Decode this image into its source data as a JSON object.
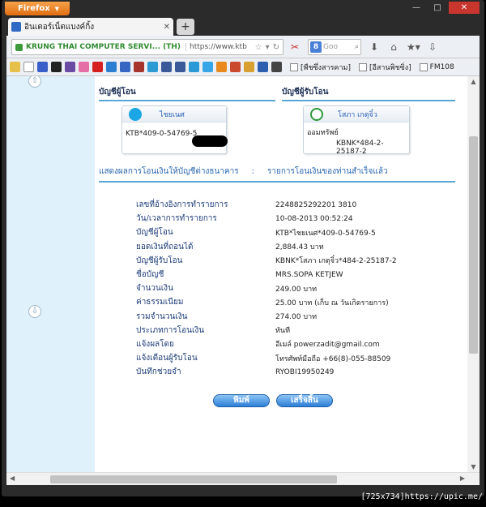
{
  "browser": {
    "app_button": "Firefox",
    "window_controls": {
      "minimize": "—",
      "maximize": "□",
      "close": "✕"
    },
    "tab": {
      "title": "อินเตอร์เน็ตแบงค์กิ้ง",
      "close": "✕"
    },
    "new_tab": "+",
    "url_identity": "KRUNG THAI COMPUTER SERVI... (TH)",
    "url": "https://www.ktb",
    "search_placeholder": "Goo",
    "bookmarks": [
      "[พืชซึ่งสารคาม]",
      "[อีสานพิชซิ่ง]",
      "FM108"
    ]
  },
  "page": {
    "sender_header": "บัญชีผู้โอน",
    "receiver_header": "บัญชีผู้รับโอน",
    "sender_card": {
      "name": "ไชยเนศ",
      "account": "KTB*409-0-54769-5"
    },
    "receiver_card": {
      "name": "โสภา เกตุจิ๋ว",
      "type": "ออมทรัพย์",
      "account": "KBNK*484-2-25187-2"
    },
    "result_label": "แสดงผลการโอนเงินให้บัญชีต่างธนาคาร",
    "result_sep": ":",
    "result_status": "รายการโอนเงินของท่านสำเร็จแล้ว",
    "details": [
      {
        "label": "เลขที่อ้างอิงการทำรายการ",
        "value": "2248825292201 3810"
      },
      {
        "label": "วัน/เวลาการทำรายการ",
        "value": "10-08-2013 00:52:24"
      },
      {
        "label": "บัญชีผู้โอน",
        "value": "KTB*ไชยเนศ*409-0-54769-5"
      },
      {
        "label": "ยอดเงินที่ถอนได้",
        "value": "2,884.43 บาท"
      },
      {
        "label": "บัญชีผู้รับโอน",
        "value": "KBNK*โสภา เกตุจิ๋ว*484-2-25187-2"
      },
      {
        "label": "ชื่อบัญชี",
        "value": "MRS.SOPA KETJEW"
      },
      {
        "label": "จำนวนเงิน",
        "value": "249.00 บาท"
      },
      {
        "label": "ค่าธรรมเนียม",
        "value": "25.00 บาท (เก็บ ณ วันเกิดรายการ)"
      },
      {
        "label": "รวมจำนวนเงิน",
        "value": "274.00 บาท"
      },
      {
        "label": "ประเภทการโอนเงิน",
        "value": "ทันที"
      },
      {
        "label": "แจ้งผลโดย",
        "value": "อีเมล์    powerzadit@gmail.com"
      },
      {
        "label": "แจ้งเตือนผู้รับโอน",
        "value": "โทรศัพท์มือถือ +66(8)-055-88509"
      },
      {
        "label": "บันทึกช่วยจำ",
        "value": "RYOBI19950249"
      }
    ],
    "print_button": "พิมพ์",
    "finish_button": "เสร็จสิ้น"
  },
  "watermark": "[725x734]https://upic.me/",
  "colors": {
    "accent": "#5aa7d6",
    "label_blue": "#1d3d78",
    "left_panel": "#dff1fb",
    "firefox_orange": "#e06d12"
  }
}
